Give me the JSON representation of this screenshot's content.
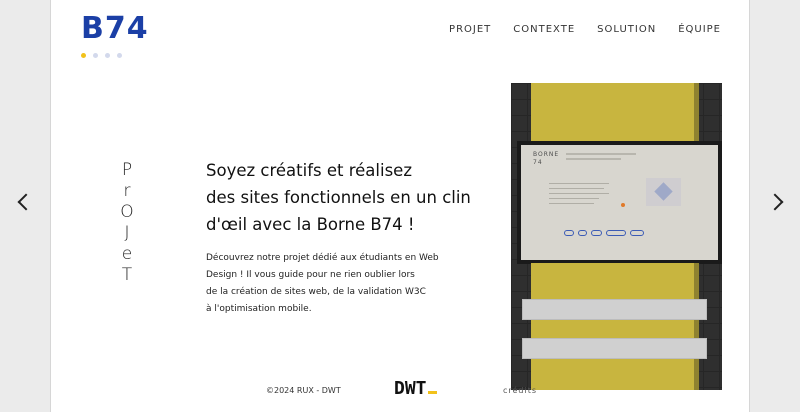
{
  "header": {
    "logo": "B74",
    "nav": [
      {
        "label": "PROJET"
      },
      {
        "label": "CONTEXTE"
      },
      {
        "label": "SOLUTION"
      },
      {
        "label": "ÉQUIPE"
      }
    ],
    "slider_dots": 4,
    "active_dot": 1
  },
  "section": {
    "vertical_title": [
      "P",
      "r",
      "O",
      "J",
      "e",
      "T"
    ],
    "headline": [
      "Soyez créatifs et réalisez",
      "des sites fonctionnels en un clin",
      "d'œil avec la Borne B74 !"
    ],
    "description": [
      "Découvrez notre projet dédié aux étudiants en Web",
      "Design ! Il vous guide pour ne rien oublier lors",
      "de la création de sites web, de la validation W3C",
      "à l'optimisation mobile."
    ]
  },
  "mockup": {
    "screen_title": "BORNE\n74"
  },
  "footer": {
    "copyright": "©2024 RUX - DWT",
    "dwt_logo": "DWT",
    "credits": "crédits"
  },
  "colors": {
    "brand_blue": "#1b3fa6",
    "accent_yellow": "#f2c21b",
    "mock_yellow": "#c8b53f"
  }
}
